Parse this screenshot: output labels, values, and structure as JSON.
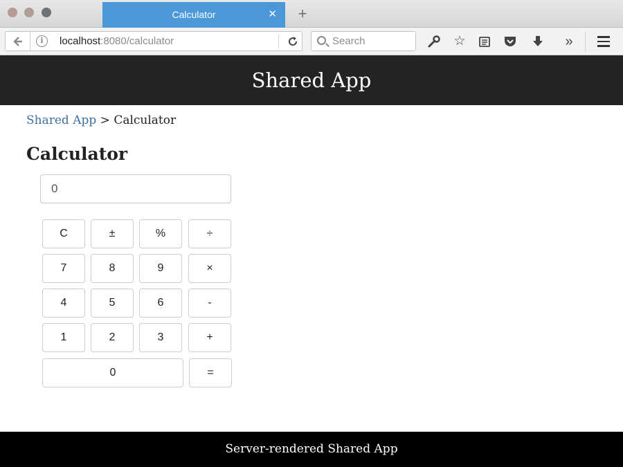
{
  "browser": {
    "tab_title": "Calculator",
    "tab_close": "✕",
    "new_tab": "+",
    "url_host": "localhost",
    "url_path": ":8080/calculator",
    "search_placeholder": "Search",
    "icons": [
      "back-arrow-icon",
      "info-icon",
      "reload-icon",
      "search-icon",
      "wrench-icon",
      "star-icon",
      "reader-icon",
      "pocket-icon",
      "download-icon",
      "overflow-icon",
      "menu-icon"
    ]
  },
  "app": {
    "header_title": "Shared App",
    "footer_text": "Server-rendered Shared App"
  },
  "breadcrumb": {
    "home": "Shared App",
    "separator": " > ",
    "current": "Calculator"
  },
  "page_title": "Calculator",
  "calculator": {
    "display_value": "0",
    "keys": [
      "C",
      "±",
      "%",
      "÷",
      "7",
      "8",
      "9",
      "×",
      "4",
      "5",
      "6",
      "-",
      "1",
      "2",
      "3",
      "+",
      "0",
      "="
    ]
  }
}
